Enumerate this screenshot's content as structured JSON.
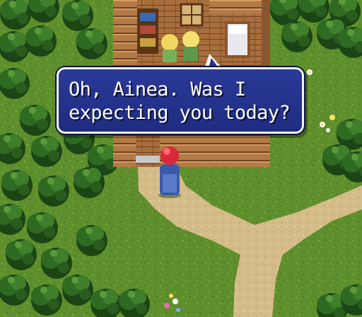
{
  "dialog": {
    "lines": [
      "Oh, Ainea. Was I",
      "expecting you today?"
    ]
  },
  "colors": {
    "grass": "#5a8a2a",
    "grass_light": "#72a23a",
    "path": "#d8c08a",
    "tree_dark": "#1f4a18",
    "tree_light": "#3c7a28",
    "log_wall": "#b07844",
    "log_dark": "#6e4422",
    "dialog_bg": "#24338c",
    "dialog_border": "#f4f4f4"
  }
}
